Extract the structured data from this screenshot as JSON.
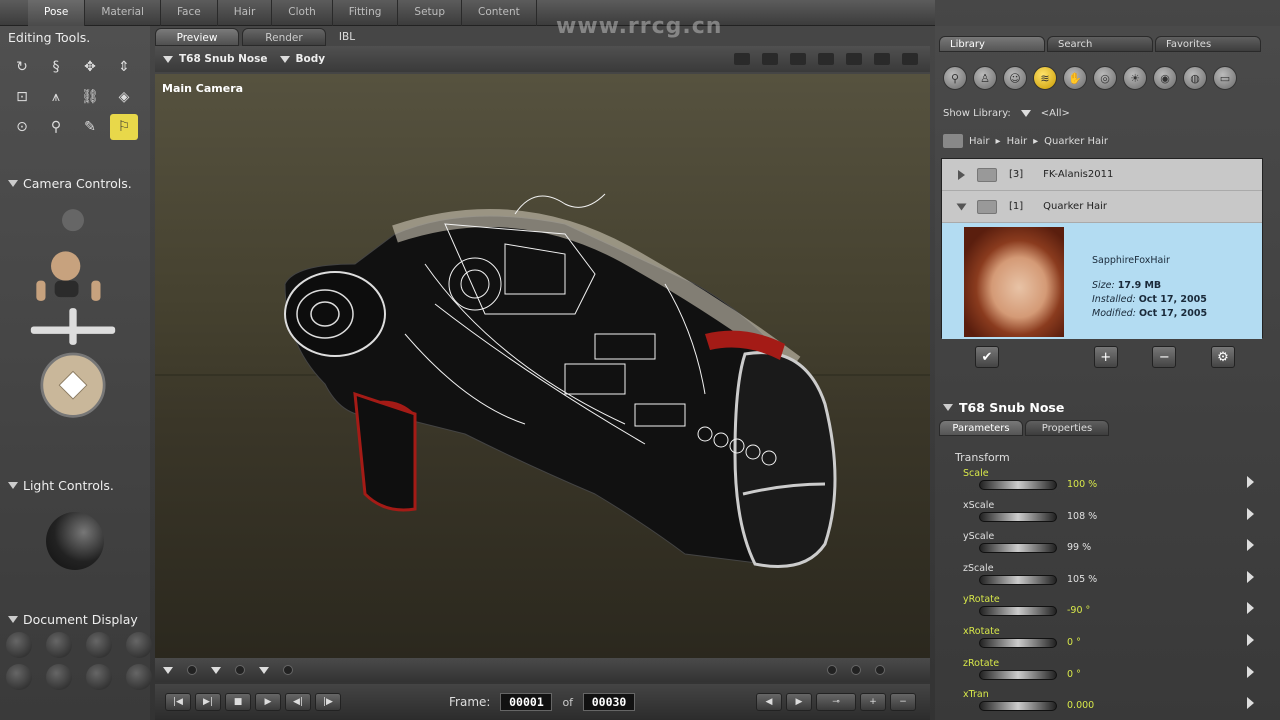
{
  "rooms": [
    "Pose",
    "Material",
    "Face",
    "Hair",
    "Cloth",
    "Fitting",
    "Setup",
    "Content"
  ],
  "watermark": "www.rrcg.cn",
  "left_panel": {
    "editing_tools_title": "Editing Tools.",
    "camera_controls_title": "Camera Controls.",
    "light_controls_title": "Light Controls.",
    "document_display_title": "Document Display"
  },
  "viewport": {
    "tabs": [
      "Preview",
      "Render",
      "IBL"
    ],
    "actor_menu": "T68 Snub Nose",
    "body_part_menu": "Body",
    "camera_label": "Main Camera"
  },
  "animation": {
    "frame_label": "Frame:",
    "current_frame": "00001",
    "of_label": "of",
    "total_frames": "00030"
  },
  "library": {
    "tabs": [
      "Library",
      "Search",
      "Favorites"
    ],
    "show_library_label": "Show Library:",
    "show_library_value": "<All>",
    "breadcrumb": [
      "Hair",
      "Hair",
      "Quarker Hair"
    ],
    "folders": [
      {
        "count": "[3]",
        "name": "FK-Alanis2011"
      },
      {
        "count": "[1]",
        "name": "Quarker Hair"
      }
    ],
    "selected_item": {
      "name": "SapphireFoxHair",
      "size_label": "Size:",
      "size": "17.9 MB",
      "installed_label": "Installed:",
      "installed": "Oct 17, 2005",
      "modified_label": "Modified:",
      "modified": "Oct 17, 2005"
    }
  },
  "parameters": {
    "title": "T68 Snub Nose",
    "tabs": [
      "Parameters",
      "Properties"
    ],
    "group": "Transform",
    "dials": [
      {
        "name": "Scale",
        "value": "100 %",
        "highlight": true
      },
      {
        "name": "xScale",
        "value": "108 %",
        "highlight": false
      },
      {
        "name": "yScale",
        "value": "99 %",
        "highlight": false
      },
      {
        "name": "zScale",
        "value": "105 %",
        "highlight": false
      },
      {
        "name": "yRotate",
        "value": "-90 °",
        "highlight": true
      },
      {
        "name": "xRotate",
        "value": "0 °",
        "highlight": true
      },
      {
        "name": "zRotate",
        "value": "0 °",
        "highlight": true
      },
      {
        "name": "xTran",
        "value": "0.000",
        "highlight": true
      }
    ]
  },
  "colors": {
    "accent_yellow": "#e8d84a",
    "dial_highlight": "#d8e84a",
    "dial_normal": "#e0e0e0",
    "library_preview_bg": "#b3dcf2"
  }
}
